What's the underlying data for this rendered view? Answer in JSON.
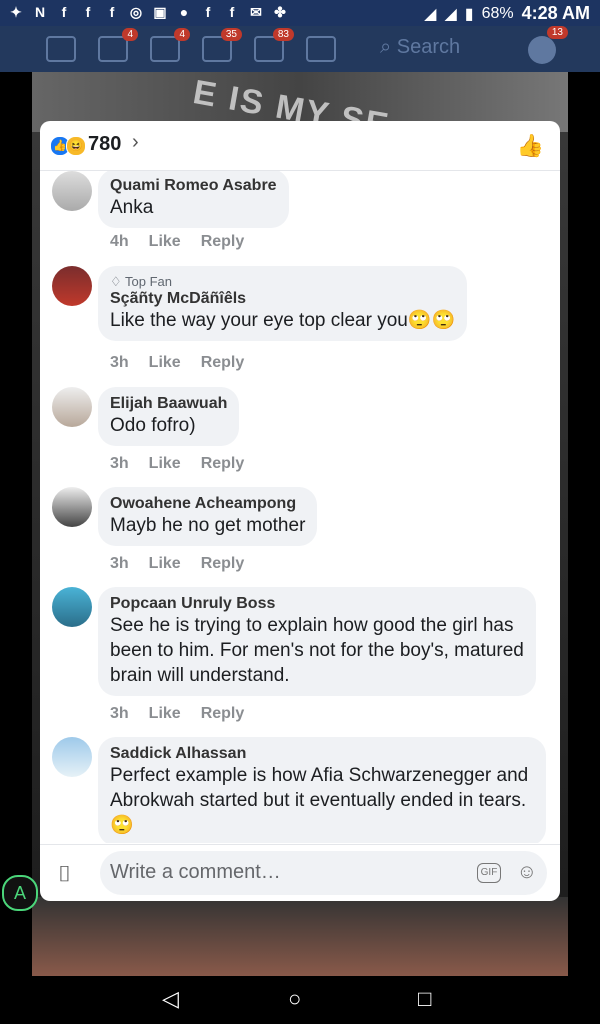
{
  "statusbar": {
    "left_icons": [
      "network-icon",
      "app-icon",
      "fb-icon",
      "fb-icon",
      "fb-icon",
      "whatsapp-icon",
      "gallery-icon",
      "circle-icon",
      "fb-icon",
      "fb-icon",
      "mail-icon",
      "pinwheel-icon"
    ],
    "battery": "68%",
    "time": "4:28 AM"
  },
  "topnav": {
    "badges": {
      "friends": "4",
      "groups": "4",
      "watch": "35",
      "notifications": "83",
      "messenger": "13"
    },
    "search_placeholder": "Search"
  },
  "background": {
    "watermark": "E IS MY SE"
  },
  "reactions": {
    "count": "780"
  },
  "comments": [
    {
      "author": "Quami Romeo Asabre",
      "text": "Anka",
      "time": "4h",
      "like": "Like",
      "reply": "Reply"
    },
    {
      "top_fan": "Top Fan",
      "author": "Sçãñty McDãñîêls",
      "text": "Like the way your eye top clear you🙄🙄",
      "time": "3h",
      "like": "Like",
      "reply": "Reply"
    },
    {
      "author": "Elijah Baawuah",
      "text": "Odo fofro)",
      "time": "3h",
      "like": "Like",
      "reply": "Reply"
    },
    {
      "author": "Owoahene Acheampong",
      "text": "Mayb he no get mother",
      "time": "3h",
      "like": "Like",
      "reply": "Reply"
    },
    {
      "author": "Popcaan Unruly Boss",
      "text": "See he is trying to explain how good the girl has been to him. For men's not for the boy's, matured brain will understand.",
      "time": "3h",
      "like": "Like",
      "reply": "Reply"
    },
    {
      "author": "Saddick Alhassan",
      "text": "Perfect example is how Afia Schwarzenegger and Abrokwah started but it eventually ended in tears. 🙄",
      "time": "",
      "like": "",
      "reply": ""
    }
  ],
  "composer": {
    "placeholder": "Write a comment…",
    "gif_label": "GIF"
  },
  "colors": {
    "accent": "#1877f2",
    "header": "#23395d"
  }
}
